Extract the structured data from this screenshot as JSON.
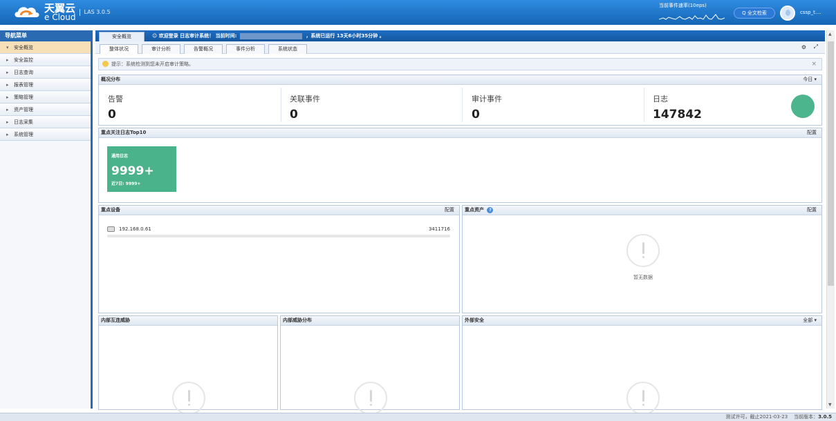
{
  "header": {
    "brand_cn": "天翼云",
    "brand_en": "e Cloud",
    "version": "LAS 3.0.5",
    "event_rate_label": "当前事件速率(10eps)",
    "search_label": "Q 全文检索",
    "username": "cssp_t...."
  },
  "nav": {
    "title": "导航菜单",
    "items": [
      {
        "label": "安全概览"
      },
      {
        "label": "安全监控"
      },
      {
        "label": "日志查询"
      },
      {
        "label": "报表管理"
      },
      {
        "label": "策略管理"
      },
      {
        "label": "资产管理"
      },
      {
        "label": "日志采集"
      },
      {
        "label": "系统管理"
      }
    ]
  },
  "tabbar": {
    "active_tab": "安全概览",
    "welcome": "☺ 欢迎登录 日志审计系统！ 当前时间:",
    "uptime": "，系统已运行 13天6小时35分钟 。"
  },
  "subtabs": [
    {
      "label": "整体状况"
    },
    {
      "label": "审计分析"
    },
    {
      "label": "告警概况"
    },
    {
      "label": "事件分析"
    },
    {
      "label": "系统状态"
    }
  ],
  "tip": {
    "text": "提示：系统检测到您未开启审计策略。"
  },
  "overview": {
    "title": "概况分布",
    "range": "今日 ▾",
    "stats": [
      {
        "label": "告警",
        "value": "0"
      },
      {
        "label": "关联事件",
        "value": "0"
      },
      {
        "label": "审计事件",
        "value": "0"
      },
      {
        "label": "日志",
        "value": "147842"
      }
    ]
  },
  "top10": {
    "title": "重点关注日志Top10",
    "config": "配置",
    "card": {
      "title": "通用日志",
      "value": "9999+",
      "sub": "近7日: 9999+"
    }
  },
  "devices": {
    "title": "重点设备",
    "config": "配置",
    "rows": [
      {
        "ip": "192.168.0.61",
        "count": "3411716"
      }
    ]
  },
  "assets": {
    "title": "重点资产",
    "config": "配置",
    "empty": "暂无数据"
  },
  "bottom": {
    "internal_threat": "内部互连威胁",
    "internal_dist": "内部威胁分布",
    "external": "外部安全",
    "external_range": "全部 ▾"
  },
  "footer": {
    "license": "测试许可，截止2021-03-23",
    "version_label": "当前版本：",
    "version": "3.0.5"
  }
}
